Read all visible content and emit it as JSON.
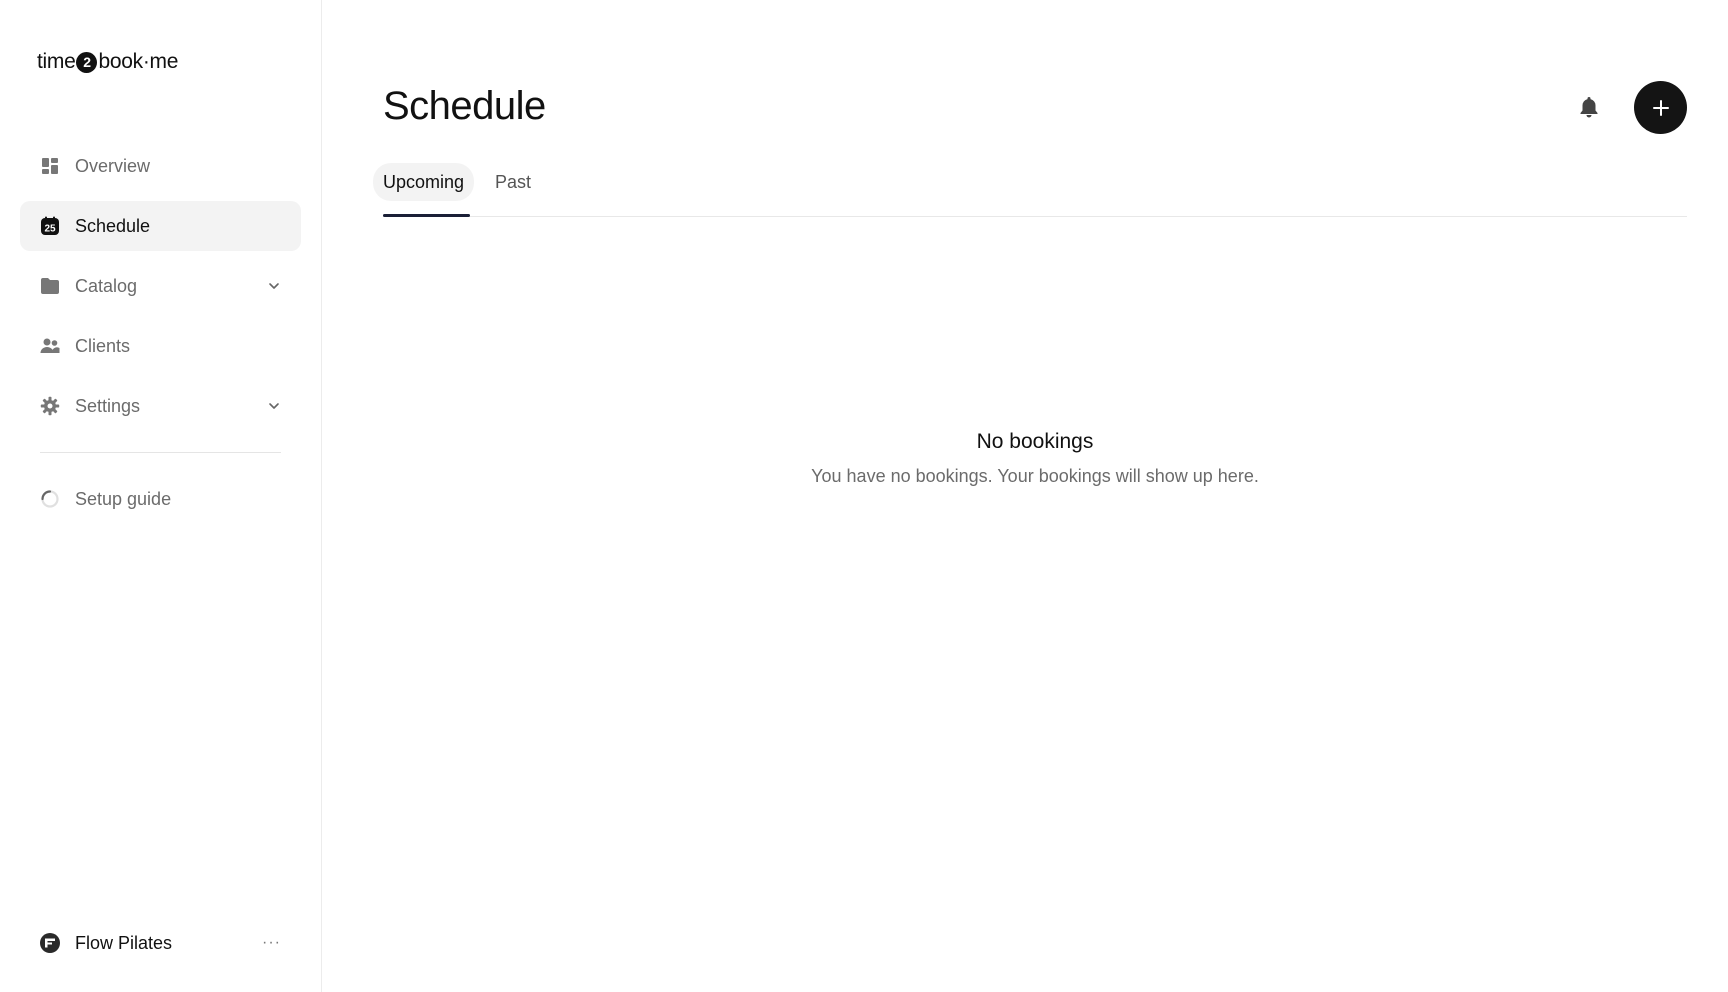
{
  "app": {
    "logo_left": "time",
    "logo_mid": "2",
    "logo_right": "book·me"
  },
  "sidebar": {
    "items": [
      {
        "label": "Overview",
        "icon": "dashboard-icon"
      },
      {
        "label": "Schedule",
        "icon": "calendar-icon",
        "active": true,
        "badge": "25"
      },
      {
        "label": "Catalog",
        "icon": "folder-icon",
        "expandable": true
      },
      {
        "label": "Clients",
        "icon": "users-icon"
      },
      {
        "label": "Settings",
        "icon": "gear-icon",
        "expandable": true
      }
    ],
    "setup_label": "Setup guide",
    "account_name": "Flow Pilates",
    "account_more": "···"
  },
  "header": {
    "title": "Schedule"
  },
  "tabs": [
    {
      "label": "Upcoming",
      "active": true
    },
    {
      "label": "Past"
    }
  ],
  "empty_state": {
    "title": "No bookings",
    "description": "You have no bookings. Your bookings will show up here."
  },
  "colors": {
    "accent_dark": "#141414",
    "tab_underline": "#1a1f36",
    "muted_text": "#6b6b6b"
  }
}
